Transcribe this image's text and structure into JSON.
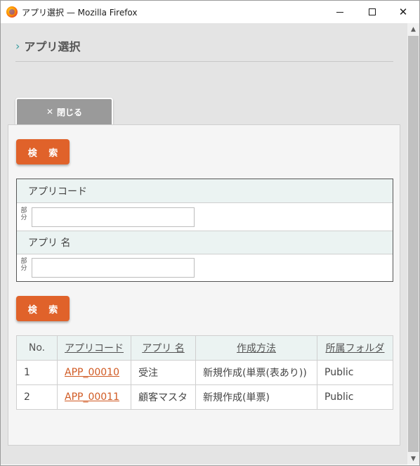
{
  "window": {
    "title": "アプリ選択 — Mozilla Firefox"
  },
  "page": {
    "title": "アプリ選択",
    "close_label": "閉じる",
    "search_label": "検 索"
  },
  "form": {
    "fields": [
      {
        "label": "アプリコード",
        "partial_label": "部\n分",
        "value": ""
      },
      {
        "label": "アプリ 名",
        "partial_label": "部\n分",
        "value": ""
      }
    ]
  },
  "table": {
    "headers": [
      "No.",
      "アプリコード",
      "アプリ 名",
      "作成方法",
      "所属フォルダ"
    ],
    "rows": [
      [
        "1",
        "APP_00010",
        "受注",
        "新規作成(単票(表あり))",
        "Public"
      ],
      [
        "2",
        "APP_00011",
        "顧客マスタ",
        "新規作成(単票)",
        "Public"
      ]
    ]
  },
  "colors": {
    "accent": "#e0622a",
    "link": "#d05a23",
    "header_bg": "#ebf3f2",
    "chevron": "#3a9ea0"
  },
  "icons": {
    "app": "firefox-icon",
    "minimize": "minimize-icon",
    "maximize": "maximize-icon",
    "close": "close-icon",
    "title_marker": "chevron-right-icon"
  }
}
